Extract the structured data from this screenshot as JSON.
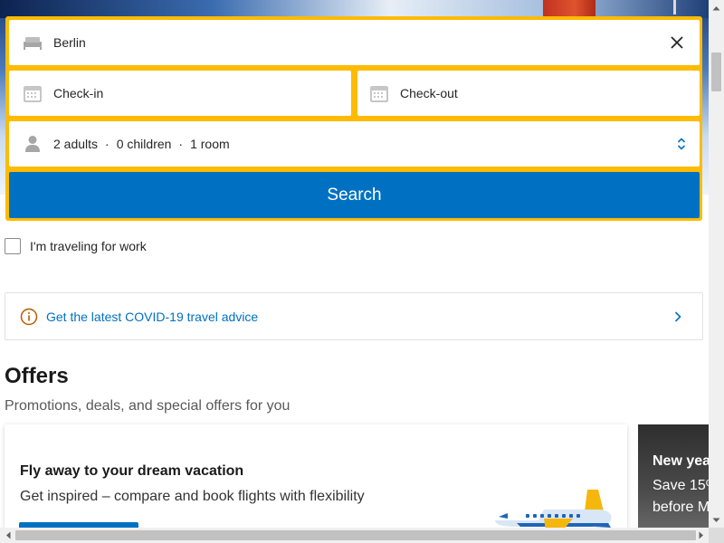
{
  "search": {
    "destination_value": "Berlin",
    "checkin_label": "Check-in",
    "checkout_label": "Check-out",
    "guests": {
      "adults": "2 adults",
      "children": "0 children",
      "rooms": "1 room",
      "separator": "·"
    },
    "search_button_label": "Search",
    "accent_color": "#febb02",
    "button_color": "#0071c2"
  },
  "work_travel": {
    "label": "I'm traveling for work",
    "checked": false
  },
  "covid_banner": {
    "link_text": "Get the latest COVID-19 travel advice",
    "icon": "info-icon"
  },
  "offers": {
    "title": "Offers",
    "subtitle": "Promotions, deals, and special offers for you",
    "cards": [
      {
        "title": "Fly away to your dream vacation",
        "description": "Get inspired – compare and book flights with flexibility",
        "icon": "airplane-illustration"
      },
      {
        "title": "New yea",
        "line2": "Save 15%",
        "line3": "before M"
      }
    ]
  },
  "icons": {
    "destination": "bed-icon",
    "clear": "close-icon",
    "checkin": "calendar-icon",
    "checkout": "calendar-icon",
    "guests": "person-icon",
    "guests_spinner": "up-down-chevron-icon",
    "covid_chevron": "chevron-right-icon"
  }
}
